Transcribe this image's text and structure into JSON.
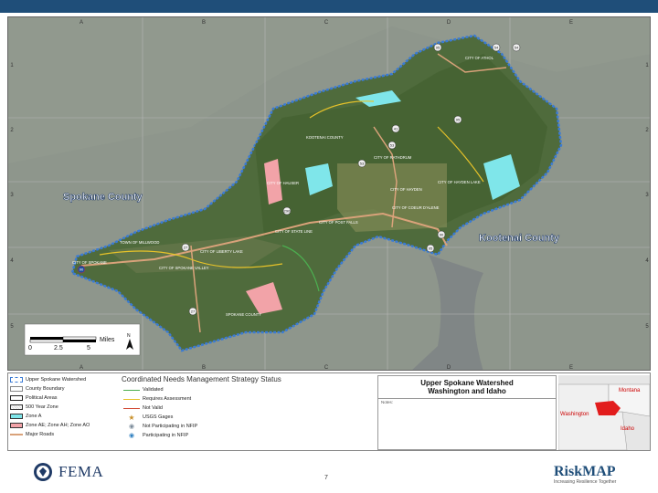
{
  "map": {
    "grid_columns": [
      "A",
      "B",
      "C",
      "D",
      "E"
    ],
    "grid_rows": [
      "1",
      "2",
      "3",
      "4",
      "5"
    ],
    "county_labels": {
      "spokane": "Spokane County",
      "kootenai": "Kootenai County"
    },
    "place_labels": [
      "CITY OF ATHOL",
      "KOOTENAI COUNTY",
      "CITY OF RATHDRUM",
      "CITY OF HAUSER",
      "CITY OF HAYDEN",
      "CITY OF HAYDEN LAKE",
      "CITY OF COEUR D'ALENE",
      "CITY OF POST FALLS",
      "CITY OF STATE LINE",
      "TOWN OF MILLWOOD",
      "CITY OF LIBERTY LAKE",
      "CITY OF SPOKANE",
      "CITY OF SPOKANE VALLEY",
      "SPOKANE COUNTY"
    ],
    "route_shields": [
      "95",
      "54",
      "54",
      "41",
      "95",
      "53",
      "53",
      "90",
      "95",
      "27",
      "27",
      "290",
      "90"
    ],
    "scale": {
      "ticks": [
        "0",
        "2.5",
        "5"
      ],
      "unit": "Miles",
      "north": "N"
    }
  },
  "legend": {
    "col1": [
      {
        "label": "Upper Spokane Watershed",
        "swatch": "#3a7bd5",
        "style": "dashed"
      },
      {
        "label": "County Boundary",
        "swatch": "#888888",
        "style": "solid"
      },
      {
        "label": "Political Areas",
        "swatch": "#ffffff",
        "style": "box"
      },
      {
        "label": "500 Year Zone",
        "swatch": "#e8e8e8",
        "style": "box"
      },
      {
        "label": "Zone A",
        "swatch": "#7fe6ea",
        "style": "box"
      },
      {
        "label": "Zone AE; Zone AH; Zone AO",
        "swatch": "#f2a3a8",
        "style": "box"
      },
      {
        "label": "Major Roads",
        "swatch": "#d9a27a",
        "style": "line"
      }
    ],
    "col2_title": "Coordinated Needs Management Strategy Status",
    "col2": [
      {
        "label": "Validated",
        "color": "#4caf50",
        "kind": "line"
      },
      {
        "label": "Requires Assessment",
        "color": "#e6c229",
        "kind": "line"
      },
      {
        "label": "Not Valid",
        "color": "#d0452e",
        "kind": "line"
      },
      {
        "label": "USGS Gages",
        "color": "#c8902a",
        "kind": "star"
      },
      {
        "label": "Not Participating in NFIP",
        "color": "#7a8a99",
        "kind": "dot"
      },
      {
        "label": "Participating in NFIP",
        "color": "#2e7fc0",
        "kind": "dot"
      }
    ],
    "title": "Upper Spokane Watershed\nWashington and Idaho",
    "notes_label": "Notes:",
    "inset": {
      "labels": [
        "Montana",
        "Washington",
        "Idaho"
      ]
    }
  },
  "footer": {
    "agency": "FEMA",
    "page_number": "7",
    "brand": "RiskMAP",
    "brand_tagline": "Increasing Resilience Together"
  },
  "colors": {
    "topbar": "#1f4e79",
    "watershed_border": "#3a7bd5",
    "zone_a": "#7fe6ea",
    "zone_ae": "#f2a3a8"
  }
}
